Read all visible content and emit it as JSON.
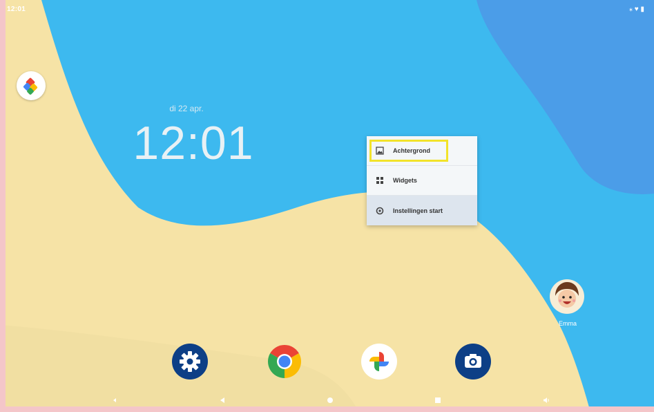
{
  "status_bar": {
    "time": "12:01",
    "right_icons": "⁎ ♥ ▮"
  },
  "clock": {
    "date": "di 22 apr.",
    "time": "12:01"
  },
  "context_menu": {
    "items": [
      {
        "label": "Achtergrond",
        "icon": "wallpaper-icon"
      },
      {
        "label": "Widgets",
        "icon": "widgets-icon"
      },
      {
        "label": "Instellingen start",
        "icon": "settings-icon"
      }
    ],
    "highlight_color": "#f2e32a"
  },
  "home": {
    "assistant_icon": "google-assistant-icon",
    "contact": {
      "label": "Emma",
      "icon": "contact-avatar-icon"
    }
  },
  "dock": [
    {
      "name": "Instellingen",
      "icon": "settings-gear-icon"
    },
    {
      "name": "Chrome",
      "icon": "chrome-icon"
    },
    {
      "name": "Foto's",
      "icon": "google-photos-icon"
    },
    {
      "name": "Camera",
      "icon": "camera-icon"
    }
  ],
  "navigation": [
    "overview-left",
    "back",
    "home",
    "recents",
    "volume"
  ],
  "colors": {
    "sky": "#3db9ef",
    "sand": "#f6e3a6",
    "deep_blue": "#4b9de8",
    "dock_blue": "#0d3f86"
  }
}
